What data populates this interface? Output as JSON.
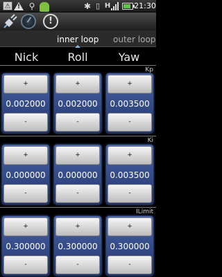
{
  "status_bar": {
    "icons": [
      "warning-box-icon",
      "alert-icon",
      "usb-icon",
      "android-icon",
      "bluetooth-icon",
      "vibrate-icon",
      "hspa-icon",
      "signal-icon",
      "battery-icon"
    ],
    "alert_glyph": "!",
    "h_glyph": "H",
    "time": "21:30"
  },
  "app_bar": {
    "icons": [
      "plug-icon",
      "gauge-icon",
      "warning-circle-icon"
    ],
    "warning_glyph": "!"
  },
  "tabs": [
    {
      "label": "inner loop",
      "selected": true
    },
    {
      "label": "outer loop",
      "selected": false
    }
  ],
  "columns": [
    "Nick",
    "Roll",
    "Yaw"
  ],
  "sections": [
    {
      "title": "Kp",
      "values": [
        "0.002000",
        "0.002000",
        "0.003500"
      ]
    },
    {
      "title": "Ki",
      "values": [
        "0.000000",
        "0.000000",
        "0.003500"
      ]
    },
    {
      "title": "ILimit",
      "values": [
        "0.300000",
        "0.300000",
        "0.300000"
      ]
    }
  ],
  "buttons": {
    "plus": "+",
    "minus": "-"
  },
  "colors": {
    "accent": "#7db9e8",
    "panel": "#3a529a"
  }
}
